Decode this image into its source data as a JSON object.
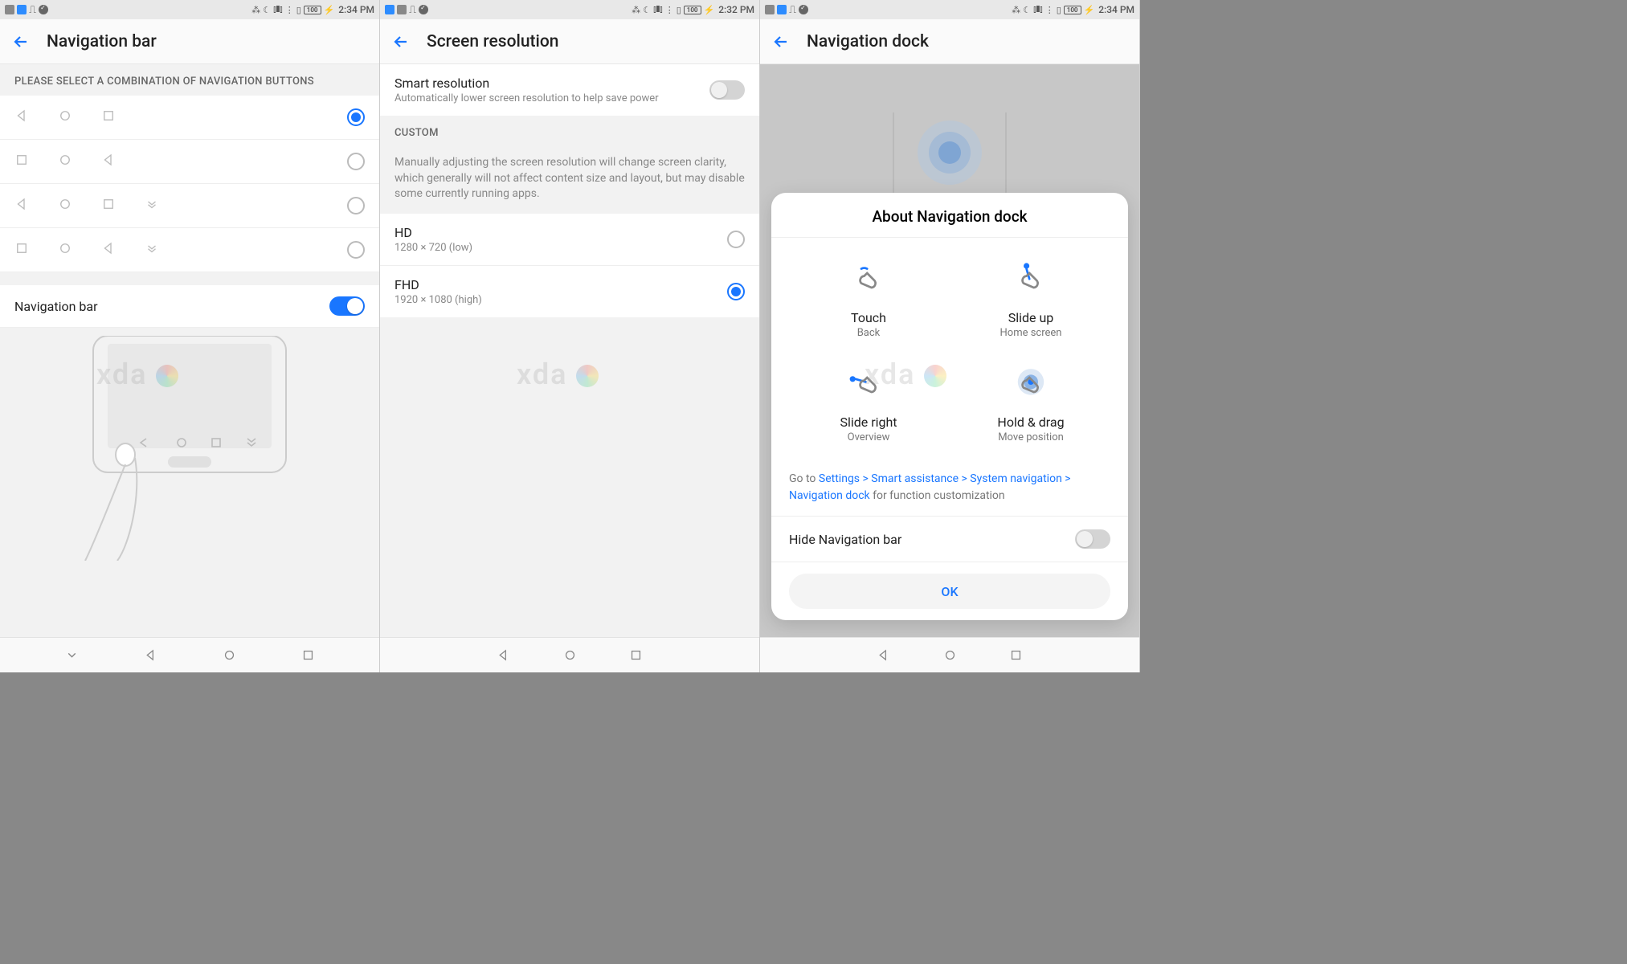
{
  "watermark": "xda",
  "status_icons": [
    "activity-icon",
    "cloud-icon",
    "usb-icon",
    "check-icon"
  ],
  "status_right_icons": [
    "bluetooth-icon",
    "dnd-icon",
    "vibrate-icon",
    "wifi-icon",
    "sim-icon"
  ],
  "battery": "100",
  "screen1": {
    "time": "2:34 PM",
    "title": "Navigation bar",
    "section_header": "PLEASE SELECT A COMBINATION OF NAVIGATION BUTTONS",
    "combos": [
      {
        "icons": [
          "back",
          "home",
          "recent"
        ],
        "selected": true
      },
      {
        "icons": [
          "recent",
          "home",
          "back"
        ],
        "selected": false
      },
      {
        "icons": [
          "back",
          "home",
          "recent",
          "notif"
        ],
        "selected": false
      },
      {
        "icons": [
          "recent",
          "home",
          "back",
          "notif"
        ],
        "selected": false
      }
    ],
    "toggle_row": {
      "label": "Navigation bar",
      "on": true
    }
  },
  "screen2": {
    "time": "2:32 PM",
    "title": "Screen resolution",
    "smart": {
      "title": "Smart resolution",
      "sub": "Automatically lower screen resolution to help save power",
      "on": false
    },
    "custom_header": "CUSTOM",
    "custom_desc": "Manually adjusting the screen resolution will change screen clarity, which generally will not affect content size and layout, but may disable some currently running apps.",
    "options": [
      {
        "title": "HD",
        "sub": "1280 × 720 (low)",
        "selected": false
      },
      {
        "title": "FHD",
        "sub": "1920 × 1080 (high)",
        "selected": true
      }
    ]
  },
  "screen3": {
    "time": "2:34 PM",
    "title": "Navigation dock",
    "modal_title": "About Navigation dock",
    "gestures": [
      {
        "title": "Touch",
        "sub": "Back"
      },
      {
        "title": "Slide up",
        "sub": "Home screen"
      },
      {
        "title": "Slide right",
        "sub": "Overview"
      },
      {
        "title": "Hold & drag",
        "sub": "Move position"
      }
    ],
    "link_prefix": "Go to ",
    "link_path": "Settings > Smart assistance > System navigation > Navigation dock",
    "link_suffix": " for function customization",
    "hide_label": "Hide Navigation bar",
    "hide_on": false,
    "ok": "OK"
  }
}
